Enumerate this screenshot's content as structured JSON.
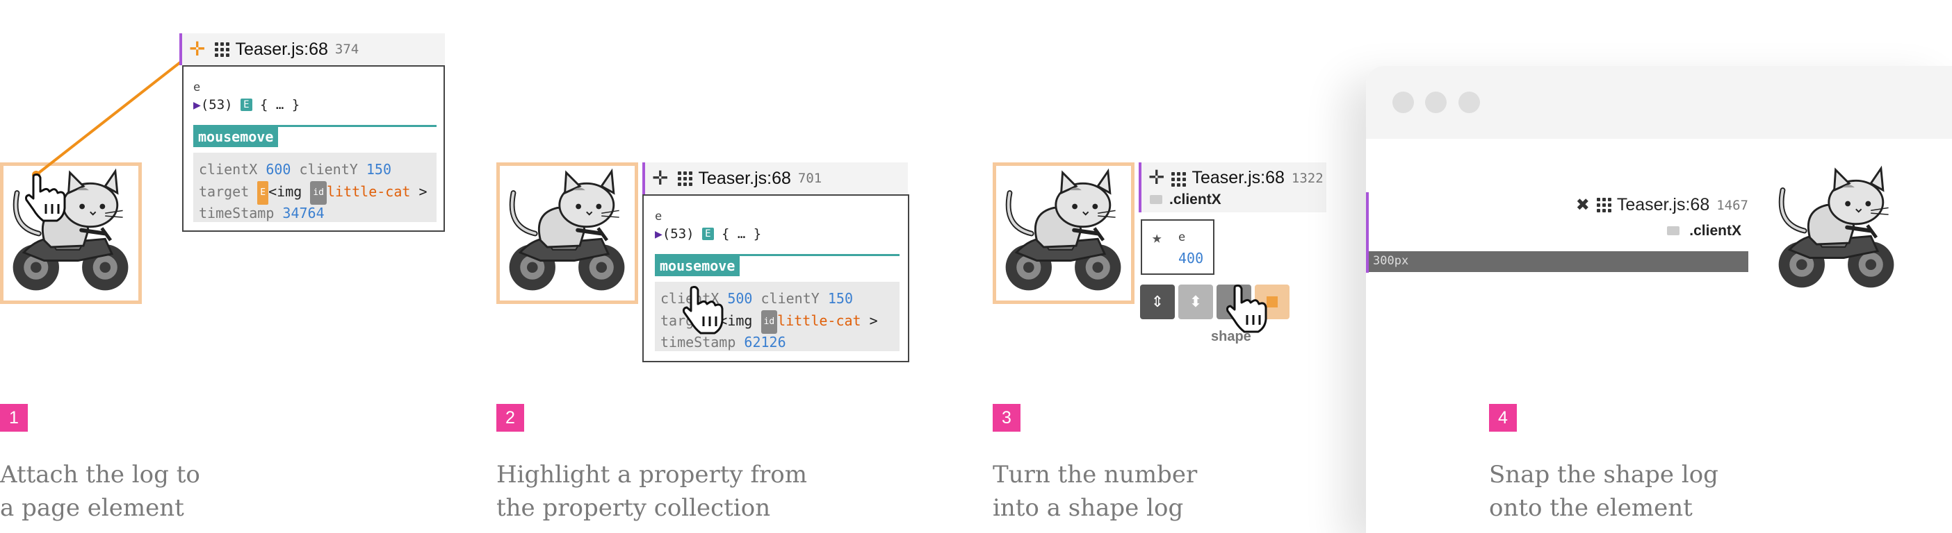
{
  "steps": [
    {
      "number": "1",
      "caption_line1": "Attach the log to",
      "caption_line2": "a page element",
      "log_file": "Teaser.js:68",
      "log_num": "374",
      "var": "e",
      "array_text": "(53)",
      "e_badge": "E",
      "obj_text": "{ … }",
      "event": "mousemove",
      "clientX_key": "clientX",
      "clientX_val": "600",
      "clientY_key": "clientY",
      "clientY_val": "150",
      "target_key": "target",
      "target_badge": "E",
      "target_tag": "<img",
      "id_badge": "id",
      "target_id": "little-cat",
      "target_close": ">",
      "timestamp_key": "timeStamp",
      "timestamp_val": "34764"
    },
    {
      "number": "2",
      "caption_line1": "Highlight a property from",
      "caption_line2": "the property collection",
      "log_file": "Teaser.js:68",
      "log_num": "701",
      "var": "e",
      "array_text": "(53)",
      "e_badge": "E",
      "obj_text": "{ … }",
      "event": "mousemove",
      "clientX_key": "clientX",
      "clientX_val": "500",
      "clientY_key": "clientY",
      "clientY_val": "150",
      "target_key": "target",
      "target_tag": "<img",
      "id_badge": "id",
      "target_id": "little-cat",
      "target_close": ">",
      "timestamp_key": "timeStamp",
      "timestamp_val": "62126"
    },
    {
      "number": "3",
      "caption_line1": "Turn the number",
      "caption_line2": "into a shape log",
      "log_file": "Teaser.js:68",
      "log_num": "1322",
      "prop": ".clientX",
      "var": "e",
      "value": "400",
      "shape_label": "shape"
    },
    {
      "number": "4",
      "caption_line1": "Snap the shape log",
      "caption_line2": "onto the element",
      "log_file": "Teaser.js:68",
      "log_num": "1467",
      "prop": ".clientX",
      "ruler": "300px"
    }
  ],
  "colors": {
    "accent_pink": "#ee3c9a",
    "teal": "#3ea5a0",
    "purple_bar": "#a855d8",
    "frame_orange": "#f6c99c",
    "link_orange": "#f0901a",
    "value_blue": "#3a7fd0"
  },
  "icons": [
    "move-icon",
    "grip-icon",
    "hand-cursor-icon",
    "cat-motorcycle-image",
    "star-icon",
    "sort-icon",
    "pin-icon"
  ]
}
